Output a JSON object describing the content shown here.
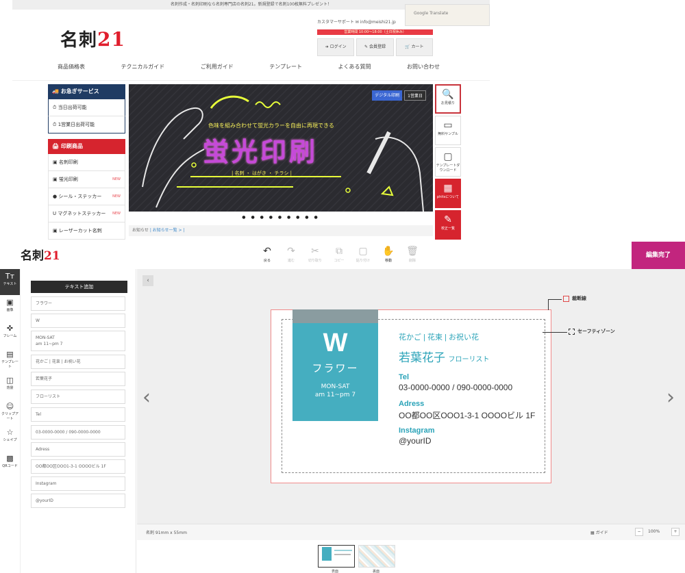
{
  "site": {
    "announcement": "名刺作成・名刺印刷なら名刺専門店の名刺21。新規登録で名刺100枚無料プレゼント！",
    "logo_text": "名刺",
    "logo_num": "21",
    "support_text": "カスタマーサポート ✉ info@meishi21.jp",
    "translate_label": "Google Translate",
    "red_strip": "営業時間 10:00〜18:00（土日祝休み）",
    "buttons": [
      {
        "icon": "➜",
        "label": "ログイン"
      },
      {
        "icon": "✎",
        "label": "会員登録"
      },
      {
        "icon": "🛒",
        "label": "カート"
      }
    ],
    "nav": [
      "商品価格表",
      "テクニカルガイド",
      "ご利用ガイド",
      "テンプレート",
      "よくある質問",
      "お問い合わせ"
    ],
    "sidebar": {
      "express_title": "お急ぎサービス",
      "express_items": [
        "当日出荷可能",
        "1営業日出荷可能"
      ],
      "print_title": "印刷商品",
      "print_items": [
        {
          "label": "名刺印刷",
          "new": ""
        },
        {
          "label": "蛍光印刷",
          "new": "NEW"
        },
        {
          "label": "シール・ステッカー",
          "new": "NEW"
        },
        {
          "label": "マグネットステッカー",
          "new": "NEW"
        },
        {
          "label": "レーザーカット名刺",
          "new": ""
        }
      ]
    },
    "banner": {
      "badge1": "デジタル印刷",
      "badge2": "1営業日",
      "tagline": "色味を組み合わせて蛍光カラーを自由に再現できる",
      "headline": "蛍光印刷",
      "subline": "| 名刺 ・ はがき ・ チラシ |"
    },
    "dots": "● ● ● ● ● ● ● ● ●",
    "news_label": "お知らせ",
    "news_link": "| お知らせ一覧 > |",
    "rail": [
      {
        "icon": "🔍",
        "label": "お見積り"
      },
      {
        "icon": "▭",
        "label": "無料サンプル"
      },
      {
        "icon": "▢",
        "label": "テンプレートダウンロード"
      },
      {
        "icon": "▦",
        "label": "phitsについて"
      },
      {
        "icon": "✎",
        "label": "校正一覧"
      },
      {
        "icon": "▯",
        "label": ""
      }
    ]
  },
  "editor": {
    "logo_text": "名刺",
    "logo_num": "21",
    "toolbar": [
      {
        "icon": "↶",
        "label": "戻る",
        "on": true
      },
      {
        "icon": "↷",
        "label": "進む",
        "on": false
      },
      {
        "icon": "✂",
        "label": "切り取り",
        "on": false
      },
      {
        "icon": "⧉",
        "label": "コピー",
        "on": false
      },
      {
        "icon": "▢",
        "label": "貼り付け",
        "on": false
      },
      {
        "icon": "✋",
        "label": "移動",
        "on": true
      },
      {
        "icon": "🗑",
        "label": "削除",
        "on": false
      }
    ],
    "done_label": "編集完了",
    "left_tools": [
      {
        "icon": "Tт",
        "label": "テキスト"
      },
      {
        "icon": "▣",
        "label": "画像"
      },
      {
        "icon": "✜",
        "label": "フレーム"
      },
      {
        "icon": "▤",
        "label": "テンプレート"
      },
      {
        "icon": "◫",
        "label": "背景"
      },
      {
        "icon": "☺",
        "label": "クリップアート"
      },
      {
        "icon": "☆",
        "label": "シェイプ"
      },
      {
        "icon": "▩",
        "label": "QRコード"
      }
    ],
    "add_text_label": "テキスト追加",
    "fields": [
      "フラワー",
      "W",
      "MON-SAT\nam 11~pm 7",
      "花かご | 花束 | お祝い花",
      "若葉花子",
      "フローリスト",
      "Tel",
      "03-0000-0000 / 090-0000-0000",
      "Adress",
      "OO都OO区OOO1-3-1 OOOOビル 1F",
      "Instagram",
      "@yourID"
    ],
    "collapse_icon": "‹",
    "prev_icon": "‹",
    "next_icon": "›",
    "card": {
      "logo_letter": "W",
      "logo_word": "フラワー",
      "hours1": "MON-SAT",
      "hours2": "am 11~pm 7",
      "services": "花かご | 花束 | お祝い花",
      "name": "若葉花子",
      "title": "フローリスト",
      "tel_label": "Tel",
      "tel": "03-0000-0000 / 090-0000-0000",
      "address_label": "Adress",
      "address": "OO都OO区OOO1-3-1 OOOOビル 1F",
      "insta_label": "Instagram",
      "insta": "@yourID"
    },
    "anno_cut": "裁断線",
    "anno_safe": "セーフティゾーン",
    "size_label": "名刺 91mm x 55mm",
    "guide_label": "ガイド",
    "zoom_minus": "−",
    "zoom": "100%",
    "zoom_plus": "+",
    "thumb_labels": [
      "表面",
      "裏面"
    ],
    "colors": {
      "accent": "#c2257e",
      "teal": "#45aec0",
      "cut": "#f08a8a"
    }
  }
}
